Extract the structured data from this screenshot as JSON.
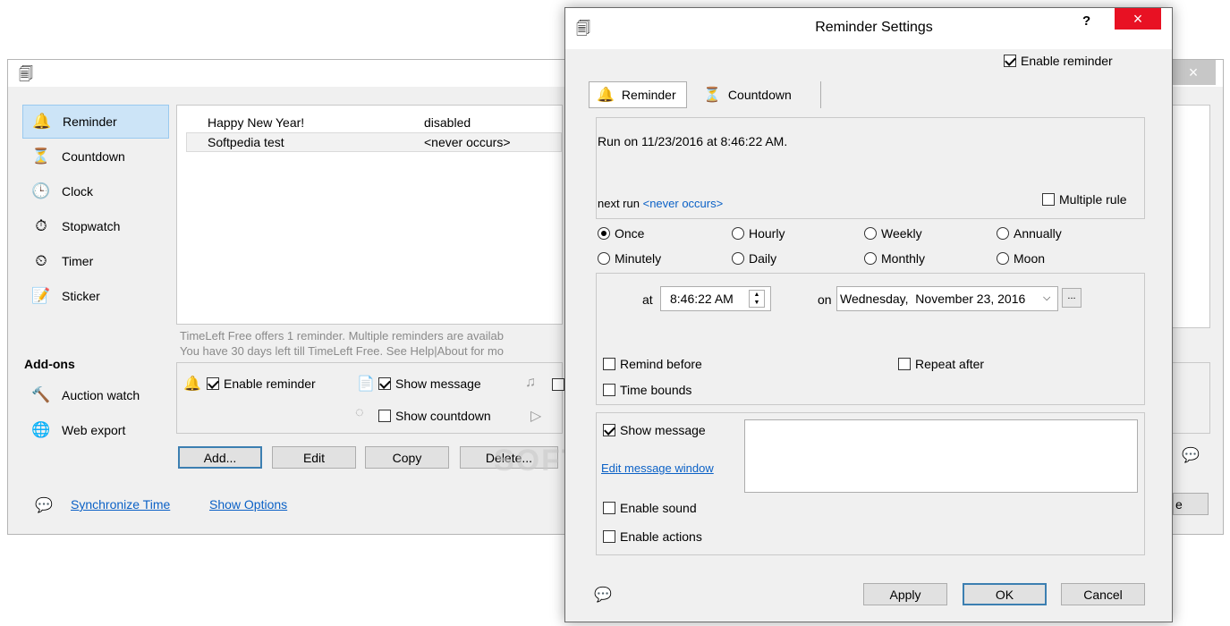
{
  "main": {
    "sidebar": [
      {
        "label": "Reminder",
        "icon": "bell-icon"
      },
      {
        "label": "Countdown",
        "icon": "countdown-icon"
      },
      {
        "label": "Clock",
        "icon": "clock-icon"
      },
      {
        "label": "Stopwatch",
        "icon": "stopwatch-icon"
      },
      {
        "label": "Timer",
        "icon": "timer-icon"
      },
      {
        "label": "Sticker",
        "icon": "sticker-icon"
      }
    ],
    "addons_heading": "Add-ons",
    "addons": [
      {
        "label": "Auction watch",
        "icon": "gavel-icon"
      },
      {
        "label": "Web export",
        "icon": "web-export-icon"
      }
    ],
    "rows": [
      {
        "name": "Happy New Year!",
        "status": "disabled"
      },
      {
        "name": "Softpedia test",
        "status": "<never occurs>"
      }
    ],
    "notice_line1": "TimeLeft Free offers 1 reminder. Multiple reminders are availab",
    "notice_line2": "You have 30 days left till TimeLeft Free. See Help|About for mo",
    "enable_reminder": "Enable reminder",
    "show_message": "Show message",
    "show_countdown": "Show countdown",
    "buttons": {
      "add": "Add...",
      "edit": "Edit",
      "copy": "Copy",
      "delete": "Delete..."
    },
    "sync_time": "Synchronize Time",
    "show_options": "Show Options",
    "partial_button": "e",
    "close_glyph": "×"
  },
  "dialog": {
    "title": "Reminder Settings",
    "help_glyph": "?",
    "close_glyph": "×",
    "enable_reminder": "Enable reminder",
    "tabs": [
      {
        "label": "Reminder"
      },
      {
        "label": "Countdown"
      }
    ],
    "run_text": "Run on 11/23/2016 at 8:46:22 AM.",
    "next_run_label": "next run",
    "next_run_value": "<never occurs>",
    "multiple_rule": "Multiple rule",
    "freq": [
      "Once",
      "Hourly",
      "Weekly",
      "Annually",
      "Minutely",
      "Daily",
      "Monthly",
      "Moon"
    ],
    "at_label": "at",
    "time_value": "8:46:22 AM",
    "on_label": "on",
    "date_value": "Wednesday,  November 23, 2016",
    "browse_glyph": "...",
    "remind_before": "Remind before",
    "repeat_after": "Repeat after",
    "time_bounds": "Time bounds",
    "show_message": "Show message",
    "edit_message_window": "Edit message window",
    "enable_sound": "Enable sound",
    "enable_actions": "Enable actions",
    "apply": "Apply",
    "ok": "OK",
    "cancel": "Cancel"
  },
  "watermark": "SOFTPEDIA"
}
